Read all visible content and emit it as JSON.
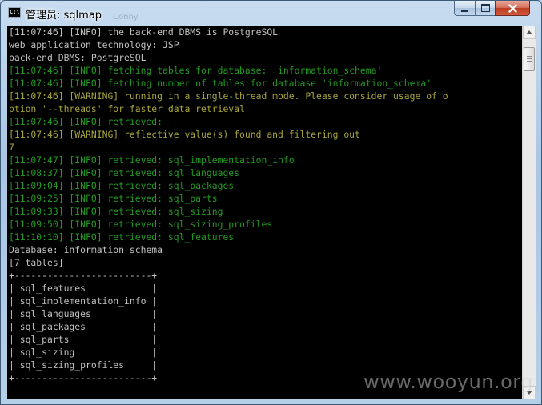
{
  "window": {
    "title": "管理员: sqlmap",
    "icon_text": "C:\\",
    "ghost_title": "Conny",
    "minimize_icon": "minimize-icon",
    "maximize_icon": "maximize-icon",
    "close_icon": "close-icon"
  },
  "console": {
    "lines": [
      {
        "text": "[11:07:46] [INFO] the back-end DBMS is PostgreSQL",
        "color": "#c0c0c0"
      },
      {
        "text": "web application technology: JSP",
        "color": "#c0c0c0"
      },
      {
        "text": "back-end DBMS: PostgreSQL",
        "color": "#c0c0c0"
      },
      {
        "text": "[11:07:46] [INFO] fetching tables for database: 'information_schema'",
        "color": "#239a23"
      },
      {
        "text": "[11:07:46] [INFO] fetching number of tables for database 'information_schema'",
        "color": "#239a23"
      },
      {
        "text": "[11:07:46] [WARNING] running in a single-thread mode. Please consider usage of o",
        "color": "#a8a53a"
      },
      {
        "text": "ption '--threads' for faster data retrieval",
        "color": "#a8a53a"
      },
      {
        "text": "[11:07:46] [INFO] retrieved:",
        "color": "#239a23"
      },
      {
        "text": "[11:07:46] [WARNING] reflective value(s) found and filtering out",
        "color": "#a8a53a"
      },
      {
        "text": "7",
        "color": "#a8a53a"
      },
      {
        "text": "[11:07:47] [INFO] retrieved: sql_implementation_info",
        "color": "#239a23"
      },
      {
        "text": "[11:08:37] [INFO] retrieved: sql_languages",
        "color": "#239a23"
      },
      {
        "text": "[11:09:04] [INFO] retrieved: sql_packages",
        "color": "#239a23"
      },
      {
        "text": "[11:09:25] [INFO] retrieved: sql_parts",
        "color": "#239a23"
      },
      {
        "text": "[11:09:33] [INFO] retrieved: sql_sizing",
        "color": "#239a23"
      },
      {
        "text": "[11:09:50] [INFO] retrieved: sql_sizing_profiles",
        "color": "#239a23"
      },
      {
        "text": "[11:10:10] [INFO] retrieved: sql_features",
        "color": "#239a23"
      },
      {
        "text": "Database: information_schema",
        "color": "#c0c0c0"
      },
      {
        "text": "[7 tables]",
        "color": "#c0c0c0"
      },
      {
        "text": "+-------------------------+",
        "color": "#c0c0c0"
      },
      {
        "text": "| sql_features            |",
        "color": "#c0c0c0"
      },
      {
        "text": "| sql_implementation_info |",
        "color": "#c0c0c0"
      },
      {
        "text": "| sql_languages           |",
        "color": "#c0c0c0"
      },
      {
        "text": "| sql_packages            |",
        "color": "#c0c0c0"
      },
      {
        "text": "| sql_parts               |",
        "color": "#c0c0c0"
      },
      {
        "text": "| sql_sizing              |",
        "color": "#c0c0c0"
      },
      {
        "text": "| sql_sizing_profiles     |",
        "color": "#c0c0c0"
      },
      {
        "text": "+-------------------------+",
        "color": "#c0c0c0"
      }
    ]
  },
  "scrollbar": {
    "up_icon": "scroll-up-arrow-icon",
    "down_icon": "scroll-down-arrow-icon"
  },
  "watermark": "www.wooyun.org",
  "colors": {
    "console_bg": "#000000",
    "info_green": "#239a23",
    "warning_yellow": "#a8a53a",
    "plain_text": "#c0c0c0"
  }
}
